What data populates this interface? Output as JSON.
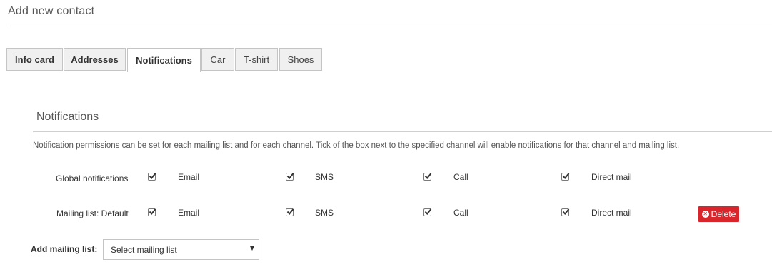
{
  "page": {
    "title": "Add new contact"
  },
  "tabs": [
    {
      "label": "Info card"
    },
    {
      "label": "Addresses"
    },
    {
      "label": "Notifications"
    },
    {
      "label": "Car"
    },
    {
      "label": "T-shirt"
    },
    {
      "label": "Shoes"
    }
  ],
  "notifications": {
    "title": "Notifications",
    "description": "Notification permissions can be set for each mailing list and for each channel. Tick of the box next to the specified channel will enable notifications for that channel and mailing list.",
    "channels": [
      "Email",
      "SMS",
      "Call",
      "Direct mail"
    ],
    "rows": [
      {
        "label": "Global notifications",
        "checked": [
          true,
          true,
          true,
          true
        ]
      },
      {
        "label": "Mailing list: Default",
        "checked": [
          true,
          true,
          true,
          true
        ],
        "delete_label": "Delete"
      }
    ]
  },
  "add_mailing_list": {
    "label": "Add mailing list:",
    "selected": "Select mailing list"
  },
  "colors": {
    "delete": "#d9262d",
    "border": "#c4c4c4"
  }
}
